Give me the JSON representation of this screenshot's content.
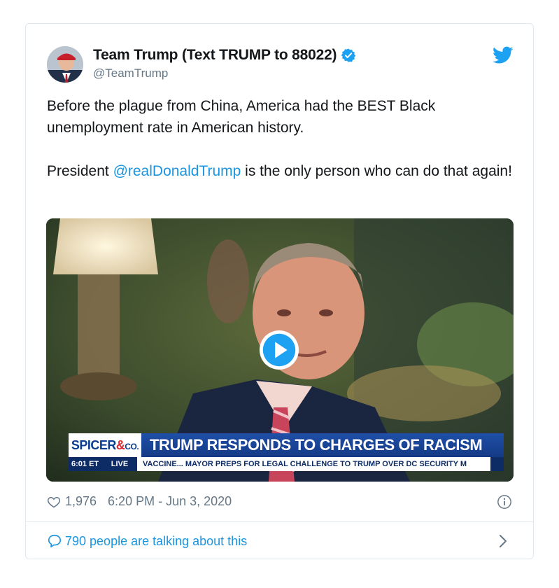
{
  "tweet": {
    "display_name": "Team Trump (Text TRUMP to 88022)",
    "handle": "@TeamTrump",
    "text_line1": "Before the plague from China, America had the BEST Black unemployment rate in American history.",
    "text_prefix": "President ",
    "mention": "@realDonaldTrump",
    "text_suffix": " is the only person who can do that again!",
    "likes": "1,976",
    "timestamp": "6:20 PM - Jun 3, 2020",
    "conversation": "790 people are talking about this"
  },
  "video": {
    "show_logo": "SPICER",
    "show_logo_amp": "&",
    "show_logo_co": "CO.",
    "headline": "TRUMP RESPONDS TO CHARGES OF RACISM",
    "time": "6:01 ET",
    "live": "LIVE",
    "ticker": "VACCINE...     MAYOR PREPS FOR LEGAL CHALLENGE TO TRUMP OVER DC SECURITY M"
  },
  "colors": {
    "link": "#1b95e0",
    "verified": "#1da1f2",
    "muted": "#657786"
  },
  "icons": [
    "verified-badge-icon",
    "twitter-bird-icon",
    "play-icon",
    "heart-icon",
    "info-icon",
    "chat-bubble-icon",
    "chevron-right-icon"
  ]
}
